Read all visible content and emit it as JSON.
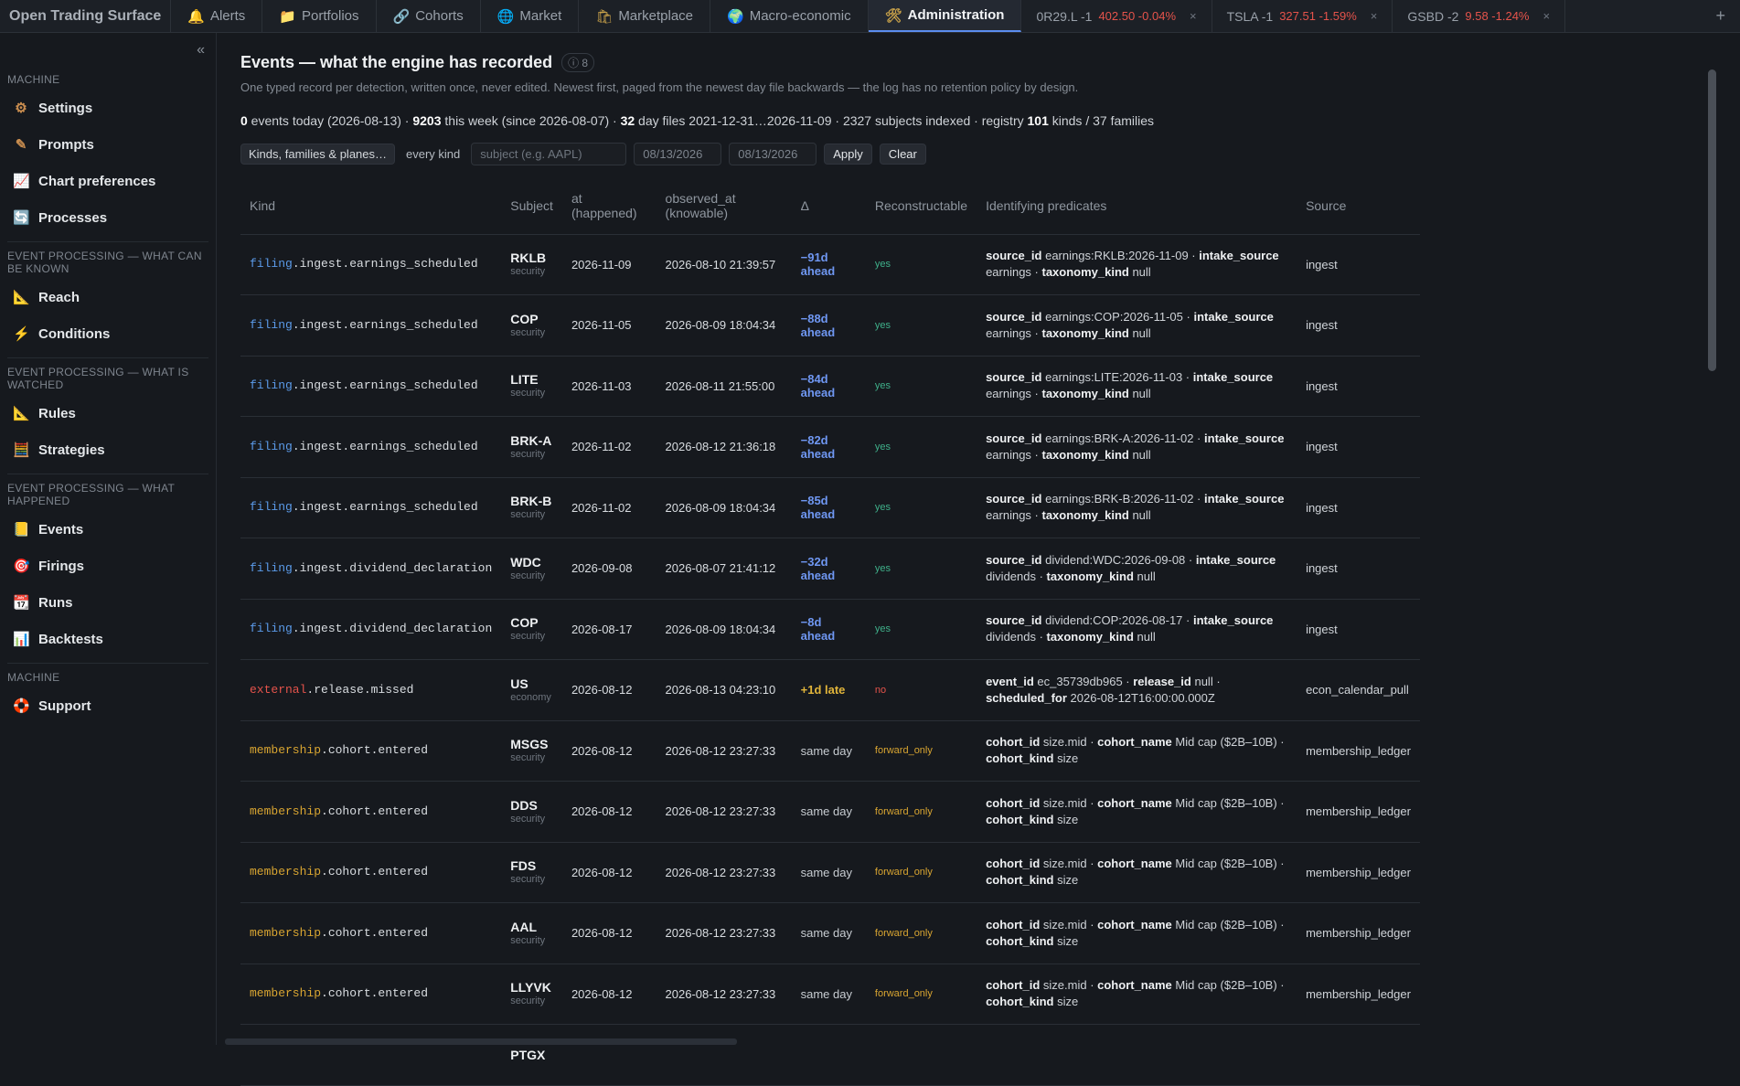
{
  "app": {
    "title": "Open Trading Surface"
  },
  "tabs": [
    {
      "label": "Alerts",
      "icon": "bell-icon",
      "glyph": "🔔",
      "active": false
    },
    {
      "label": "Portfolios",
      "icon": "folder-icon",
      "glyph": "📁",
      "active": false
    },
    {
      "label": "Cohorts",
      "icon": "link-icon",
      "glyph": "🔗",
      "active": false
    },
    {
      "label": "Market",
      "icon": "globe-icon",
      "glyph": "🌐",
      "active": false
    },
    {
      "label": "Marketplace",
      "icon": "shopping-bag-icon",
      "glyph": "🛍",
      "active": false
    },
    {
      "label": "Macro-economic",
      "icon": "earth-icon",
      "glyph": "🌍",
      "active": false
    },
    {
      "label": "Administration",
      "icon": "tools-icon",
      "glyph": "🛠",
      "active": true
    }
  ],
  "quote_tabs": [
    {
      "symbol": "0R29.L",
      "qty": "-1",
      "price": "402.50",
      "change": "-0.04%"
    },
    {
      "symbol": "TSLA",
      "qty": "-1",
      "price": "327.51",
      "change": "-1.59%"
    },
    {
      "symbol": "GSBD",
      "qty": "-2",
      "price": "9.58",
      "change": "-1.24%"
    }
  ],
  "sidebar": {
    "collapse": "«",
    "sections": [
      {
        "title": "MACHINE",
        "items": [
          {
            "label": "Settings",
            "icon": "gear-icon",
            "glyph": "⚙"
          },
          {
            "label": "Prompts",
            "icon": "pencil-icon",
            "glyph": "✎"
          },
          {
            "label": "Chart preferences",
            "icon": "chart-icon",
            "glyph": "📈"
          },
          {
            "label": "Processes",
            "icon": "refresh-icon",
            "glyph": "🔄"
          }
        ]
      },
      {
        "title": "EVENT PROCESSING — WHAT CAN BE KNOWN",
        "items": [
          {
            "label": "Reach",
            "icon": "ruler-icon",
            "glyph": "📐"
          },
          {
            "label": "Conditions",
            "icon": "lightning-icon",
            "glyph": "⚡"
          }
        ]
      },
      {
        "title": "EVENT PROCESSING — WHAT IS WATCHED",
        "items": [
          {
            "label": "Rules",
            "icon": "ruler-icon",
            "glyph": "📐"
          },
          {
            "label": "Strategies",
            "icon": "abacus-icon",
            "glyph": "🧮"
          }
        ]
      },
      {
        "title": "EVENT PROCESSING — WHAT HAPPENED",
        "items": [
          {
            "label": "Events",
            "icon": "ledger-icon",
            "glyph": "📒"
          },
          {
            "label": "Firings",
            "icon": "target-icon",
            "glyph": "🎯"
          },
          {
            "label": "Runs",
            "icon": "calendar-icon",
            "glyph": "📆"
          },
          {
            "label": "Backtests",
            "icon": "bar-chart-icon",
            "glyph": "📊"
          }
        ]
      },
      {
        "title": "MACHINE",
        "items": [
          {
            "label": "Support",
            "icon": "lifebuoy-icon",
            "glyph": "🛟"
          }
        ]
      }
    ]
  },
  "page": {
    "title": "Events — what the engine has recorded",
    "count": "ⓘ 8",
    "subtitle": "One typed record per detection, written once, never edited. Newest first, paged from the newest day file backwards — the log has no retention policy by design.",
    "stats": [
      {
        "b": "0",
        "t": " events today (2026-08-13) · "
      },
      {
        "b": "9203",
        "t": " this week (since 2026-08-07) · "
      },
      {
        "b": "32",
        "t": " day files 2021-12-31…2026-11-09 · 2327 subjects indexed · registry "
      },
      {
        "b": "101",
        "t": " kinds / 37 families"
      }
    ]
  },
  "filters": {
    "kinds_chip": "Kinds, families & planes…",
    "kind_label": "every kind",
    "subject_placeholder": "subject (e.g. AAPL)",
    "date_from": "08/13/2026",
    "date_to": "08/13/2026",
    "apply": "Apply",
    "clear": "Clear"
  },
  "table": {
    "headers": [
      "Kind",
      "Subject",
      "at (happened)",
      "observed_at (knowable)",
      "Δ",
      "Reconstructable",
      "Identifying predicates",
      "Source"
    ],
    "rows": [
      {
        "family": "filing",
        "kind_rest": ".ingest.earnings_scheduled",
        "fam_class": "kf",
        "subject": "RKLB",
        "subject_kind": "security",
        "at": "2026-11-09",
        "observed": "2026-08-10 21:39:57",
        "delta": "−91d ahead",
        "dcls": "d-ahead",
        "rec": "yes",
        "rcls": "rec-yes",
        "preds": [
          [
            "source_id",
            "earnings:RKLB:2026-11-09"
          ],
          [
            "intake_source",
            "earnings"
          ],
          [
            "taxonomy_kind",
            "null"
          ]
        ],
        "source": "ingest"
      },
      {
        "family": "filing",
        "kind_rest": ".ingest.earnings_scheduled",
        "fam_class": "kf",
        "subject": "COP",
        "subject_kind": "security",
        "at": "2026-11-05",
        "observed": "2026-08-09 18:04:34",
        "delta": "−88d ahead",
        "dcls": "d-ahead",
        "rec": "yes",
        "rcls": "rec-yes",
        "preds": [
          [
            "source_id",
            "earnings:COP:2026-11-05"
          ],
          [
            "intake_source",
            "earnings"
          ],
          [
            "taxonomy_kind",
            "null"
          ]
        ],
        "source": "ingest"
      },
      {
        "family": "filing",
        "kind_rest": ".ingest.earnings_scheduled",
        "fam_class": "kf",
        "subject": "LITE",
        "subject_kind": "security",
        "at": "2026-11-03",
        "observed": "2026-08-11 21:55:00",
        "delta": "−84d ahead",
        "dcls": "d-ahead",
        "rec": "yes",
        "rcls": "rec-yes",
        "preds": [
          [
            "source_id",
            "earnings:LITE:2026-11-03"
          ],
          [
            "intake_source",
            "earnings"
          ],
          [
            "taxonomy_kind",
            "null"
          ]
        ],
        "source": "ingest"
      },
      {
        "family": "filing",
        "kind_rest": ".ingest.earnings_scheduled",
        "fam_class": "kf",
        "subject": "BRK-A",
        "subject_kind": "security",
        "at": "2026-11-02",
        "observed": "2026-08-12 21:36:18",
        "delta": "−82d ahead",
        "dcls": "d-ahead",
        "rec": "yes",
        "rcls": "rec-yes",
        "preds": [
          [
            "source_id",
            "earnings:BRK-A:2026-11-02"
          ],
          [
            "intake_source",
            "earnings"
          ],
          [
            "taxonomy_kind",
            "null"
          ]
        ],
        "source": "ingest"
      },
      {
        "family": "filing",
        "kind_rest": ".ingest.earnings_scheduled",
        "fam_class": "kf",
        "subject": "BRK-B",
        "subject_kind": "security",
        "at": "2026-11-02",
        "observed": "2026-08-09 18:04:34",
        "delta": "−85d ahead",
        "dcls": "d-ahead",
        "rec": "yes",
        "rcls": "rec-yes",
        "preds": [
          [
            "source_id",
            "earnings:BRK-B:2026-11-02"
          ],
          [
            "intake_source",
            "earnings"
          ],
          [
            "taxonomy_kind",
            "null"
          ]
        ],
        "source": "ingest"
      },
      {
        "family": "filing",
        "kind_rest": ".ingest.dividend_declaration",
        "fam_class": "kf",
        "subject": "WDC",
        "subject_kind": "security",
        "at": "2026-09-08",
        "observed": "2026-08-07 21:41:12",
        "delta": "−32d ahead",
        "dcls": "d-ahead",
        "rec": "yes",
        "rcls": "rec-yes",
        "preds": [
          [
            "source_id",
            "dividend:WDC:2026-09-08"
          ],
          [
            "intake_source",
            "dividends"
          ],
          [
            "taxonomy_kind",
            "null"
          ]
        ],
        "source": "ingest"
      },
      {
        "family": "filing",
        "kind_rest": ".ingest.dividend_declaration",
        "fam_class": "kf",
        "subject": "COP",
        "subject_kind": "security",
        "at": "2026-08-17",
        "observed": "2026-08-09 18:04:34",
        "delta": "−8d ahead",
        "dcls": "d-ahead",
        "rec": "yes",
        "rcls": "rec-yes",
        "preds": [
          [
            "source_id",
            "dividend:COP:2026-08-17"
          ],
          [
            "intake_source",
            "dividends"
          ],
          [
            "taxonomy_kind",
            "null"
          ]
        ],
        "source": "ingest"
      },
      {
        "family": "external",
        "kind_rest": ".release.missed",
        "fam_class": "ke",
        "subject": "US",
        "subject_kind": "economy",
        "at": "2026-08-12",
        "observed": "2026-08-13 04:23:10",
        "delta": "+1d late",
        "dcls": "d-late",
        "rec": "no",
        "rcls": "rec-no",
        "preds": [
          [
            "event_id",
            "ec_35739db965"
          ],
          [
            "release_id",
            "null"
          ],
          [
            "scheduled_for",
            "2026-08-12T16:00:00.000Z"
          ]
        ],
        "source": "econ_calendar_pull"
      },
      {
        "family": "membership",
        "kind_rest": ".cohort.entered",
        "fam_class": "km",
        "subject": "MSGS",
        "subject_kind": "security",
        "at": "2026-08-12",
        "observed": "2026-08-12 23:27:33",
        "delta": "same day",
        "dcls": "d-same",
        "rec": "forward_only",
        "rcls": "rec-fwd",
        "preds": [
          [
            "cohort_id",
            "size.mid"
          ],
          [
            "cohort_name",
            "Mid cap ($2B–10B)"
          ],
          [
            "cohort_kind",
            "size"
          ]
        ],
        "source": "membership_ledger"
      },
      {
        "family": "membership",
        "kind_rest": ".cohort.entered",
        "fam_class": "km",
        "subject": "DDS",
        "subject_kind": "security",
        "at": "2026-08-12",
        "observed": "2026-08-12 23:27:33",
        "delta": "same day",
        "dcls": "d-same",
        "rec": "forward_only",
        "rcls": "rec-fwd",
        "preds": [
          [
            "cohort_id",
            "size.mid"
          ],
          [
            "cohort_name",
            "Mid cap ($2B–10B)"
          ],
          [
            "cohort_kind",
            "size"
          ]
        ],
        "source": "membership_ledger"
      },
      {
        "family": "membership",
        "kind_rest": ".cohort.entered",
        "fam_class": "km",
        "subject": "FDS",
        "subject_kind": "security",
        "at": "2026-08-12",
        "observed": "2026-08-12 23:27:33",
        "delta": "same day",
        "dcls": "d-same",
        "rec": "forward_only",
        "rcls": "rec-fwd",
        "preds": [
          [
            "cohort_id",
            "size.mid"
          ],
          [
            "cohort_name",
            "Mid cap ($2B–10B)"
          ],
          [
            "cohort_kind",
            "size"
          ]
        ],
        "source": "membership_ledger"
      },
      {
        "family": "membership",
        "kind_rest": ".cohort.entered",
        "fam_class": "km",
        "subject": "AAL",
        "subject_kind": "security",
        "at": "2026-08-12",
        "observed": "2026-08-12 23:27:33",
        "delta": "same day",
        "dcls": "d-same",
        "rec": "forward_only",
        "rcls": "rec-fwd",
        "preds": [
          [
            "cohort_id",
            "size.mid"
          ],
          [
            "cohort_name",
            "Mid cap ($2B–10B)"
          ],
          [
            "cohort_kind",
            "size"
          ]
        ],
        "source": "membership_ledger"
      },
      {
        "family": "membership",
        "kind_rest": ".cohort.entered",
        "fam_class": "km",
        "subject": "LLYVK",
        "subject_kind": "security",
        "at": "2026-08-12",
        "observed": "2026-08-12 23:27:33",
        "delta": "same day",
        "dcls": "d-same",
        "rec": "forward_only",
        "rcls": "rec-fwd",
        "preds": [
          [
            "cohort_id",
            "size.mid"
          ],
          [
            "cohort_name",
            "Mid cap ($2B–10B)"
          ],
          [
            "cohort_kind",
            "size"
          ]
        ],
        "source": "membership_ledger"
      },
      {
        "family": "",
        "kind_rest": "",
        "fam_class": "km",
        "subject": "PTGX",
        "subject_kind": "",
        "at": "",
        "observed": "",
        "delta": "",
        "dcls": "d-same",
        "rec": "",
        "rcls": "rec-fwd",
        "preds": [],
        "source": ""
      }
    ]
  }
}
